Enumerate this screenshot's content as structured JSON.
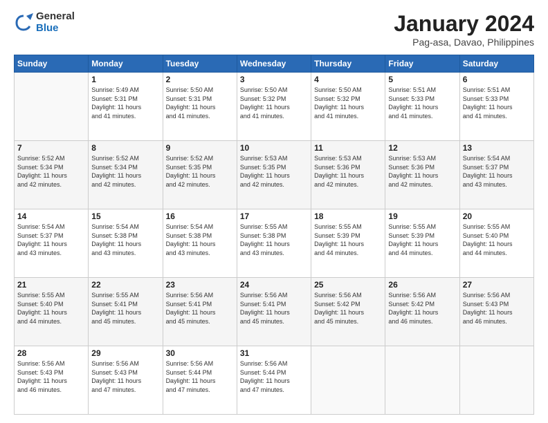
{
  "header": {
    "logo_general": "General",
    "logo_blue": "Blue",
    "title": "January 2024",
    "subtitle": "Pag-asa, Davao, Philippines"
  },
  "weekdays": [
    "Sunday",
    "Monday",
    "Tuesday",
    "Wednesday",
    "Thursday",
    "Friday",
    "Saturday"
  ],
  "weeks": [
    [
      {
        "day": "",
        "info": ""
      },
      {
        "day": "1",
        "info": "Sunrise: 5:49 AM\nSunset: 5:31 PM\nDaylight: 11 hours\nand 41 minutes."
      },
      {
        "day": "2",
        "info": "Sunrise: 5:50 AM\nSunset: 5:31 PM\nDaylight: 11 hours\nand 41 minutes."
      },
      {
        "day": "3",
        "info": "Sunrise: 5:50 AM\nSunset: 5:32 PM\nDaylight: 11 hours\nand 41 minutes."
      },
      {
        "day": "4",
        "info": "Sunrise: 5:50 AM\nSunset: 5:32 PM\nDaylight: 11 hours\nand 41 minutes."
      },
      {
        "day": "5",
        "info": "Sunrise: 5:51 AM\nSunset: 5:33 PM\nDaylight: 11 hours\nand 41 minutes."
      },
      {
        "day": "6",
        "info": "Sunrise: 5:51 AM\nSunset: 5:33 PM\nDaylight: 11 hours\nand 41 minutes."
      }
    ],
    [
      {
        "day": "7",
        "info": "Sunrise: 5:52 AM\nSunset: 5:34 PM\nDaylight: 11 hours\nand 42 minutes."
      },
      {
        "day": "8",
        "info": "Sunrise: 5:52 AM\nSunset: 5:34 PM\nDaylight: 11 hours\nand 42 minutes."
      },
      {
        "day": "9",
        "info": "Sunrise: 5:52 AM\nSunset: 5:35 PM\nDaylight: 11 hours\nand 42 minutes."
      },
      {
        "day": "10",
        "info": "Sunrise: 5:53 AM\nSunset: 5:35 PM\nDaylight: 11 hours\nand 42 minutes."
      },
      {
        "day": "11",
        "info": "Sunrise: 5:53 AM\nSunset: 5:36 PM\nDaylight: 11 hours\nand 42 minutes."
      },
      {
        "day": "12",
        "info": "Sunrise: 5:53 AM\nSunset: 5:36 PM\nDaylight: 11 hours\nand 42 minutes."
      },
      {
        "day": "13",
        "info": "Sunrise: 5:54 AM\nSunset: 5:37 PM\nDaylight: 11 hours\nand 43 minutes."
      }
    ],
    [
      {
        "day": "14",
        "info": "Sunrise: 5:54 AM\nSunset: 5:37 PM\nDaylight: 11 hours\nand 43 minutes."
      },
      {
        "day": "15",
        "info": "Sunrise: 5:54 AM\nSunset: 5:38 PM\nDaylight: 11 hours\nand 43 minutes."
      },
      {
        "day": "16",
        "info": "Sunrise: 5:54 AM\nSunset: 5:38 PM\nDaylight: 11 hours\nand 43 minutes."
      },
      {
        "day": "17",
        "info": "Sunrise: 5:55 AM\nSunset: 5:38 PM\nDaylight: 11 hours\nand 43 minutes."
      },
      {
        "day": "18",
        "info": "Sunrise: 5:55 AM\nSunset: 5:39 PM\nDaylight: 11 hours\nand 44 minutes."
      },
      {
        "day": "19",
        "info": "Sunrise: 5:55 AM\nSunset: 5:39 PM\nDaylight: 11 hours\nand 44 minutes."
      },
      {
        "day": "20",
        "info": "Sunrise: 5:55 AM\nSunset: 5:40 PM\nDaylight: 11 hours\nand 44 minutes."
      }
    ],
    [
      {
        "day": "21",
        "info": "Sunrise: 5:55 AM\nSunset: 5:40 PM\nDaylight: 11 hours\nand 44 minutes."
      },
      {
        "day": "22",
        "info": "Sunrise: 5:55 AM\nSunset: 5:41 PM\nDaylight: 11 hours\nand 45 minutes."
      },
      {
        "day": "23",
        "info": "Sunrise: 5:56 AM\nSunset: 5:41 PM\nDaylight: 11 hours\nand 45 minutes."
      },
      {
        "day": "24",
        "info": "Sunrise: 5:56 AM\nSunset: 5:41 PM\nDaylight: 11 hours\nand 45 minutes."
      },
      {
        "day": "25",
        "info": "Sunrise: 5:56 AM\nSunset: 5:42 PM\nDaylight: 11 hours\nand 45 minutes."
      },
      {
        "day": "26",
        "info": "Sunrise: 5:56 AM\nSunset: 5:42 PM\nDaylight: 11 hours\nand 46 minutes."
      },
      {
        "day": "27",
        "info": "Sunrise: 5:56 AM\nSunset: 5:43 PM\nDaylight: 11 hours\nand 46 minutes."
      }
    ],
    [
      {
        "day": "28",
        "info": "Sunrise: 5:56 AM\nSunset: 5:43 PM\nDaylight: 11 hours\nand 46 minutes."
      },
      {
        "day": "29",
        "info": "Sunrise: 5:56 AM\nSunset: 5:43 PM\nDaylight: 11 hours\nand 47 minutes."
      },
      {
        "day": "30",
        "info": "Sunrise: 5:56 AM\nSunset: 5:44 PM\nDaylight: 11 hours\nand 47 minutes."
      },
      {
        "day": "31",
        "info": "Sunrise: 5:56 AM\nSunset: 5:44 PM\nDaylight: 11 hours\nand 47 minutes."
      },
      {
        "day": "",
        "info": ""
      },
      {
        "day": "",
        "info": ""
      },
      {
        "day": "",
        "info": ""
      }
    ]
  ]
}
